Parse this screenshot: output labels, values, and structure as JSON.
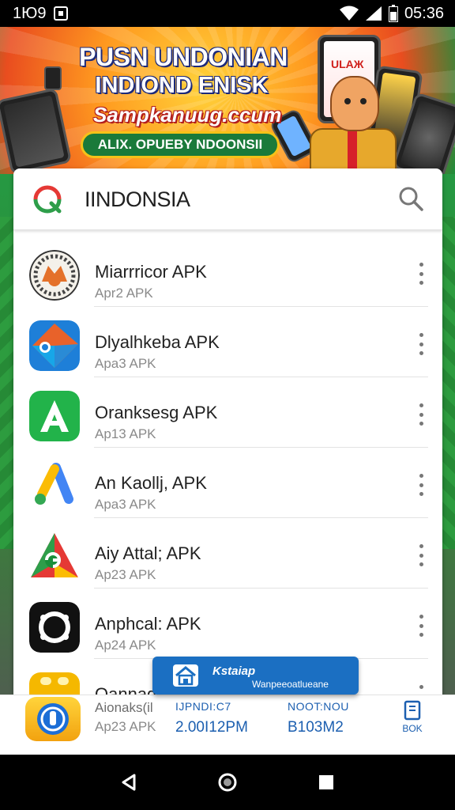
{
  "status_bar": {
    "left_text": "1Ю9",
    "time": "05:36",
    "icons": [
      "notification-icon",
      "wifi-icon",
      "signal-icon",
      "battery-icon"
    ]
  },
  "banner": {
    "title": "PUSN UNDONIAN",
    "subtitle": "INDIOND ENISK",
    "url": "Sampkanuug.ccum",
    "ribbon": "ALIX. OPUEBY NDOONSII",
    "phone_label": "ULAЖ"
  },
  "search": {
    "title": "IINDONSIA",
    "logo_icon": "q-logo-icon",
    "search_icon": "search-icon"
  },
  "apps": [
    {
      "name": "Mіarrricor APK",
      "sub": "Apr2 APK",
      "icon": "fox-emblem-icon",
      "accent": "#e4712a"
    },
    {
      "name": "Dlyalhkeba APK",
      "sub": "Apa3 APK",
      "icon": "blue-diamond-app-icon",
      "accent": "#1e7fd8"
    },
    {
      "name": "Oranksesg APK",
      "sub": "Ap13 APK",
      "icon": "green-a-app-icon",
      "accent": "#22b34a"
    },
    {
      "name": "An Kaollj, APK",
      "sub": "Apa3 APK",
      "icon": "google-ads-icon",
      "accent": "#fbbc04"
    },
    {
      "name": "Aiy Attal; APK",
      "sub": "Ap23 APK",
      "icon": "multicolor-g-app-icon",
      "accent": "#e53935"
    },
    {
      "name": "Anphcal: APK",
      "sub": "Ap24 APK",
      "icon": "black-circle-app-icon",
      "accent": "#111111"
    },
    {
      "name": "Oannaqq",
      "sub": "Aionaks(il",
      "icon": "yellow-app-icon",
      "accent": "#f5b800"
    }
  ],
  "bottom_panel": {
    "name": "Aionaks(il",
    "sub": "Ap23 APK",
    "col1_key": "IJPNDI:C7",
    "col1_value": "2.00I12PM",
    "col2_key": "NOOT:NOU",
    "col2_value": "B103M2",
    "action_label": "BOK"
  },
  "toast": {
    "title": "Kstaiap",
    "text": "Wanpeeoatlueane"
  },
  "nav": {
    "back_icon": "back-triangle-icon",
    "home_icon": "home-circle-icon",
    "recents_icon": "recents-square-icon"
  },
  "colors": {
    "accent_blue": "#1c5fb0",
    "banner_orange": "#ff9a1f",
    "background_green": "#2f8a3a"
  }
}
